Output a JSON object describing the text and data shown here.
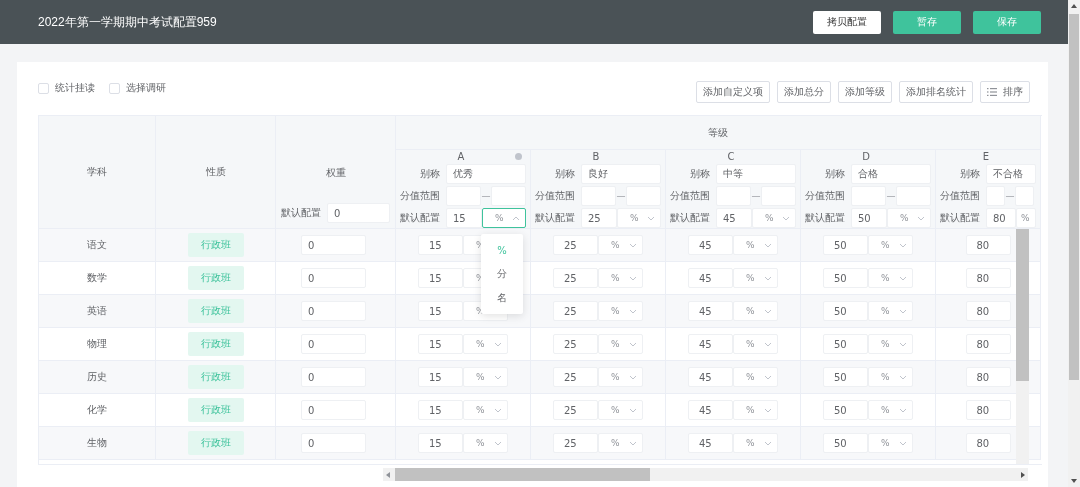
{
  "header": {
    "title": "2022年第一学期期中考试配置959",
    "buttons": [
      {
        "label": "拷贝配置",
        "kind": "secondary"
      },
      {
        "label": "暂存",
        "kind": "primary"
      },
      {
        "label": "保存",
        "kind": "primary"
      }
    ]
  },
  "options": [
    {
      "label": "统计挂读",
      "checked": false
    },
    {
      "label": "选择调研",
      "checked": false
    }
  ],
  "toolbar": [
    {
      "label": "添加自定义项",
      "kind": "plain"
    },
    {
      "label": "添加总分",
      "kind": "plain"
    },
    {
      "label": "添加等级",
      "kind": "plain"
    },
    {
      "label": "添加排名统计",
      "kind": "plain"
    },
    {
      "label": "排序",
      "kind": "sort"
    }
  ],
  "table": {
    "columns": {
      "subject": "学科",
      "type": "性质",
      "weight": "权重",
      "grade_group": "等级"
    },
    "weight_default": {
      "label": "默认配置",
      "value": "0"
    },
    "grades": [
      {
        "letter": "A",
        "alias_label": "别称",
        "alias": "优秀",
        "range_label": "分值范围",
        "range_separator": "—",
        "default_label": "默认配置",
        "default_value": "15",
        "unit": "%",
        "open": true,
        "removable": true
      },
      {
        "letter": "B",
        "alias_label": "别称",
        "alias": "良好",
        "range_label": "分值范围",
        "range_separator": "—",
        "default_label": "默认配置",
        "default_value": "25",
        "unit": "%",
        "open": false
      },
      {
        "letter": "C",
        "alias_label": "别称",
        "alias": "中等",
        "range_label": "分值范围",
        "range_separator": "—",
        "default_label": "默认配置",
        "default_value": "45",
        "unit": "%",
        "open": false
      },
      {
        "letter": "D",
        "alias_label": "别称",
        "alias": "合格",
        "range_label": "分值范围",
        "range_separator": "—",
        "default_label": "默认配置",
        "default_value": "50",
        "unit": "%",
        "open": false
      },
      {
        "letter": "E",
        "alias_label": "别称",
        "alias": "不合格",
        "range_label": "分值范围",
        "range_separator": "—",
        "default_label": "默认配置",
        "default_value": "80",
        "unit": "%"
      }
    ],
    "rows": [
      {
        "subject": "语文",
        "type": "行政班",
        "weight": "0",
        "grades": [
          {
            "value": "15",
            "unit": "%"
          },
          {
            "value": "25",
            "unit": "%"
          },
          {
            "value": "45",
            "unit": "%"
          },
          {
            "value": "50",
            "unit": "%"
          },
          {
            "value": "80"
          }
        ]
      },
      {
        "subject": "数学",
        "type": "行政班",
        "weight": "0",
        "grades": [
          {
            "value": "15",
            "unit": "%"
          },
          {
            "value": "25",
            "unit": "%"
          },
          {
            "value": "45",
            "unit": "%"
          },
          {
            "value": "50",
            "unit": "%"
          },
          {
            "value": "80"
          }
        ]
      },
      {
        "subject": "英语",
        "type": "行政班",
        "weight": "0",
        "grades": [
          {
            "value": "15",
            "unit": "%"
          },
          {
            "value": "25",
            "unit": "%"
          },
          {
            "value": "45",
            "unit": "%"
          },
          {
            "value": "50",
            "unit": "%"
          },
          {
            "value": "80"
          }
        ]
      },
      {
        "subject": "物理",
        "type": "行政班",
        "weight": "0",
        "grades": [
          {
            "value": "15",
            "unit": "%"
          },
          {
            "value": "25",
            "unit": "%"
          },
          {
            "value": "45",
            "unit": "%"
          },
          {
            "value": "50",
            "unit": "%"
          },
          {
            "value": "80"
          }
        ]
      },
      {
        "subject": "历史",
        "type": "行政班",
        "weight": "0",
        "grades": [
          {
            "value": "15",
            "unit": "%"
          },
          {
            "value": "25",
            "unit": "%"
          },
          {
            "value": "45",
            "unit": "%"
          },
          {
            "value": "50",
            "unit": "%"
          },
          {
            "value": "80"
          }
        ]
      },
      {
        "subject": "化学",
        "type": "行政班",
        "weight": "0",
        "grades": [
          {
            "value": "15",
            "unit": "%"
          },
          {
            "value": "25",
            "unit": "%"
          },
          {
            "value": "45",
            "unit": "%"
          },
          {
            "value": "50",
            "unit": "%"
          },
          {
            "value": "80"
          }
        ]
      },
      {
        "subject": "生物",
        "type": "行政班",
        "weight": "0",
        "grades": [
          {
            "value": "15",
            "unit": "%"
          },
          {
            "value": "25",
            "unit": "%"
          },
          {
            "value": "45",
            "unit": "%"
          },
          {
            "value": "50",
            "unit": "%"
          },
          {
            "value": "80"
          }
        ]
      }
    ]
  },
  "dropdown": {
    "options": [
      {
        "label": "%",
        "selected": true
      },
      {
        "label": "分",
        "selected": false
      },
      {
        "label": "名",
        "selected": false
      }
    ]
  }
}
